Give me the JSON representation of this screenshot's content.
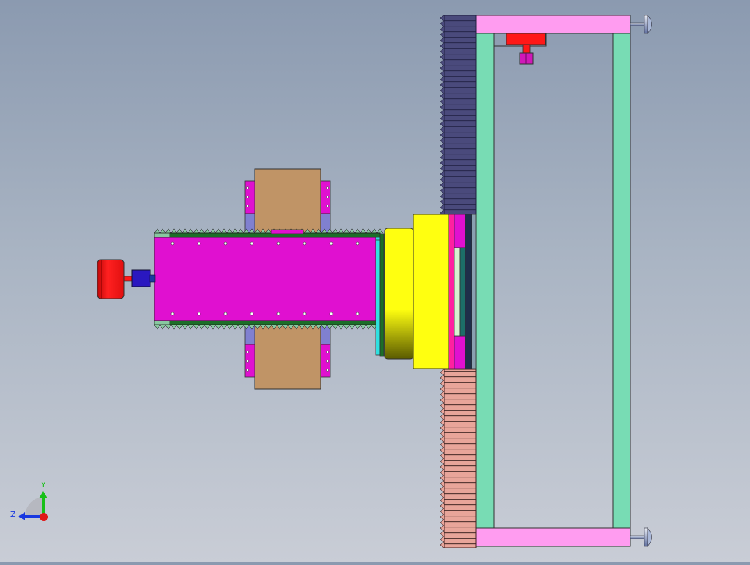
{
  "viewport": {
    "background_top": "#8b9ab0",
    "background_bottom": "#c9cdd6"
  },
  "triad": {
    "y_label": "Y",
    "z_label": "Z",
    "y_color": "#18c018",
    "z_color": "#1838e0",
    "x_color": "#e01818"
  },
  "colors": {
    "frame_green": "#78dcb4",
    "frame_pink": "#ff9cf0",
    "rack_blue": "#4a4a7c",
    "rack_salmon": "#e8a59a",
    "carriage_magenta": "#e010d0",
    "block_tan": "#c09466",
    "plate_yellow": "#ffff10",
    "motor_red": "#ff1818",
    "coupler_blue": "#2a18c0",
    "rail_green": "#1c6e28",
    "cyan": "#30e0e0",
    "slot_purple": "#8080d0"
  }
}
